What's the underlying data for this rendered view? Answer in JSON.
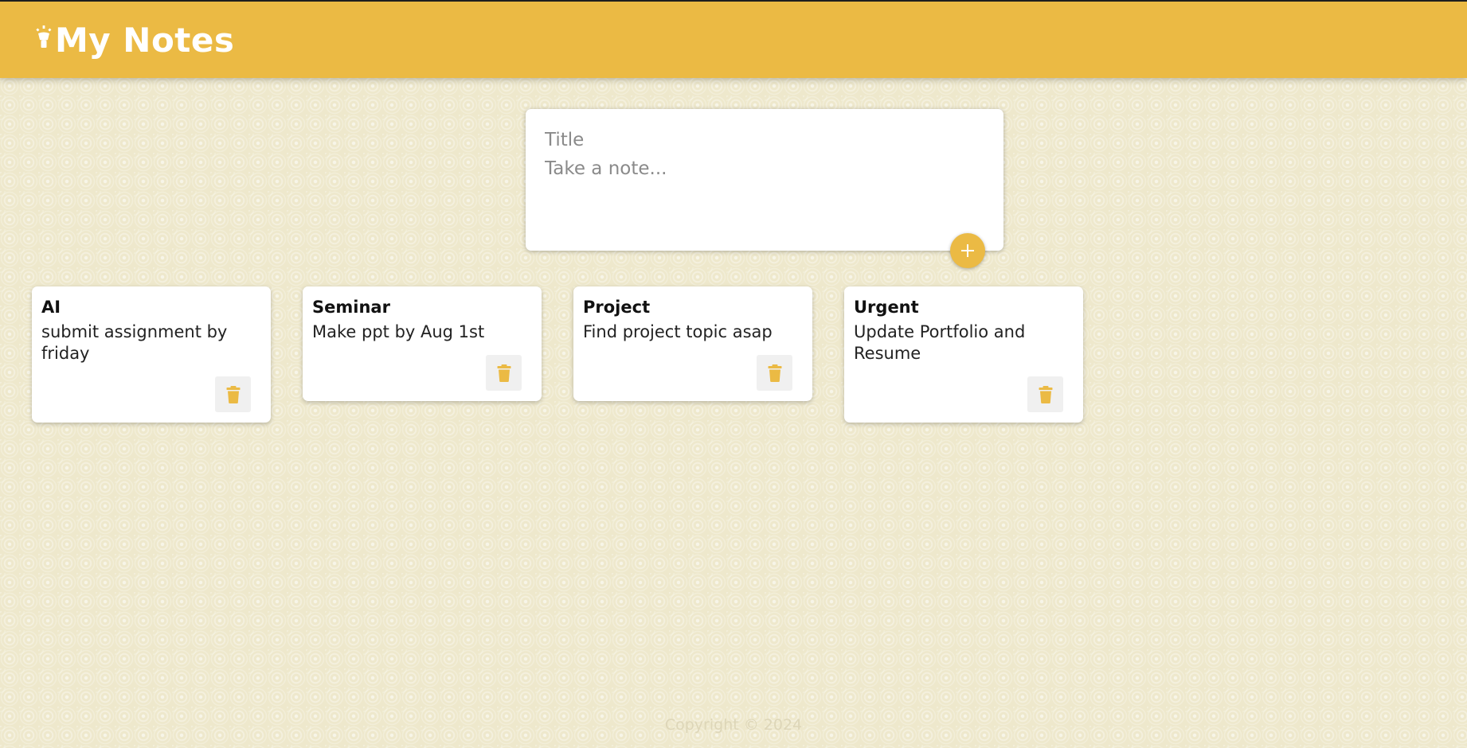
{
  "header": {
    "title": "My Notes",
    "logo_icon": "lightbulb-icon"
  },
  "composer": {
    "title_placeholder": "Title",
    "content_placeholder": "Take a note...",
    "add_icon": "plus-icon"
  },
  "notes": [
    {
      "title": "AI",
      "content": "submit assignment by friday",
      "delete_icon": "trash-icon"
    },
    {
      "title": "Seminar",
      "content": "Make ppt by  Aug 1st",
      "delete_icon": "trash-icon"
    },
    {
      "title": "Project",
      "content": "Find project topic asap",
      "delete_icon": "trash-icon"
    },
    {
      "title": "Urgent",
      "content": "Update Portfolio and Resume",
      "delete_icon": "trash-icon"
    }
  ],
  "footer": {
    "text": "Copyright © 2024"
  },
  "colors": {
    "accent": "#ebba44",
    "background": "#eee8cc",
    "card": "#ffffff"
  }
}
